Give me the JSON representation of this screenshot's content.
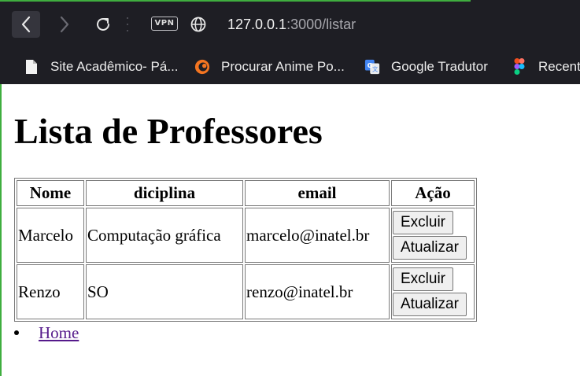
{
  "browser": {
    "vpn_label": "VPN",
    "url_host": "127.0.0.1",
    "url_path": ":3000/listar"
  },
  "bookmarks": [
    {
      "label": "Site Acadêmico- Pá...",
      "icon": "document-icon"
    },
    {
      "label": "Procurar Anime Po...",
      "icon": "crunchyroll-icon"
    },
    {
      "label": "Google Tradutor",
      "icon": "google-translate-icon"
    },
    {
      "label": "Recent",
      "icon": "figma-icon"
    }
  ],
  "page": {
    "title": "Lista de Professores",
    "table": {
      "headers": [
        "Nome",
        "diciplina",
        "email",
        "Ação"
      ],
      "rows": [
        {
          "nome": "Marcelo",
          "disciplina": "Computação gráfica",
          "email": "marcelo@inatel.br"
        },
        {
          "nome": "Renzo",
          "disciplina": "SO",
          "email": "renzo@inatel.br"
        }
      ],
      "delete_label": "Excluir",
      "update_label": "Atualizar"
    },
    "nav_links": [
      "Home"
    ]
  },
  "colors": {
    "chrome_bg": "#1e1e24",
    "link_visited": "#551a8b",
    "accent_green": "#3fae3f"
  }
}
